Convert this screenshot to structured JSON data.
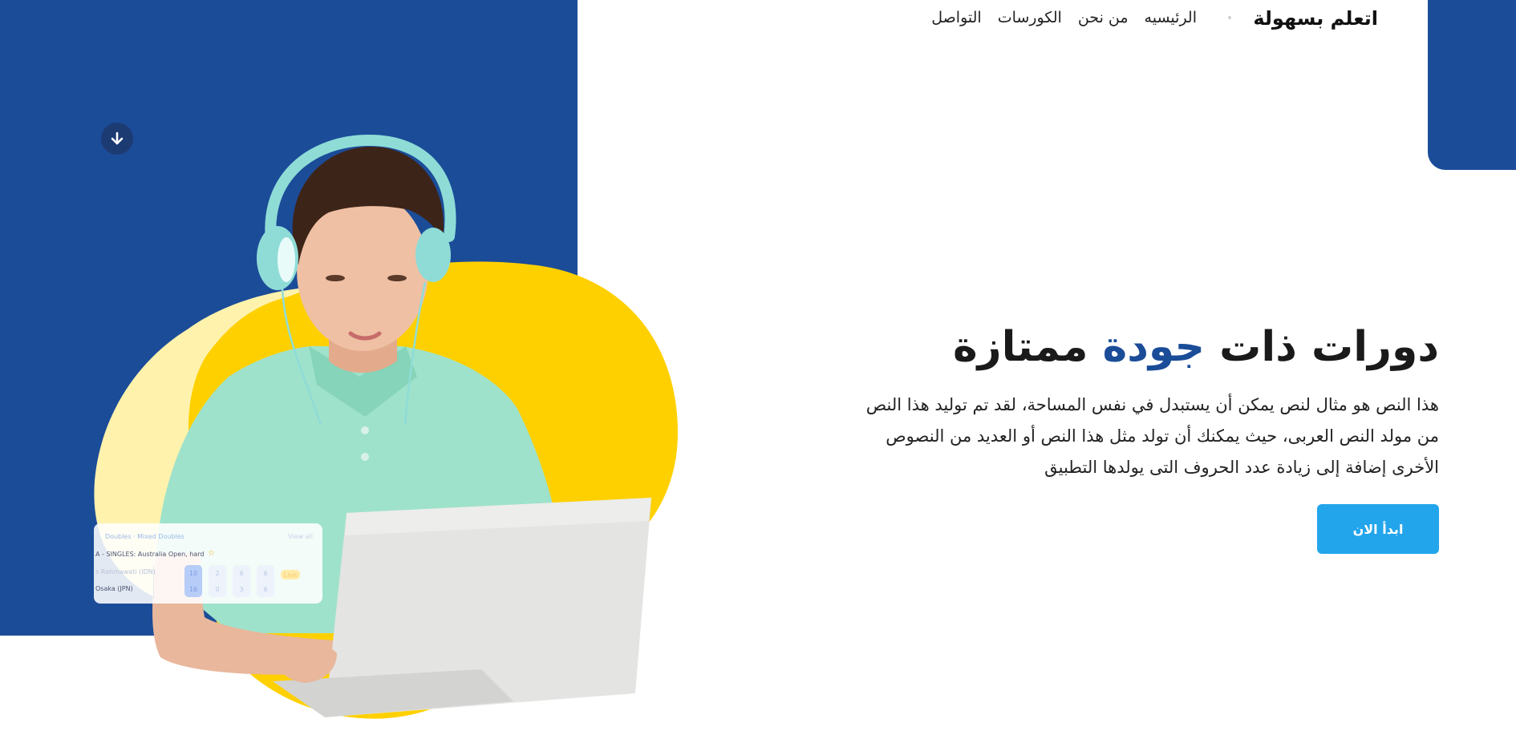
{
  "header": {
    "brand": "اتعلم بسهولة",
    "nav": [
      "الرئيسيه",
      "من نحن",
      "الكورسات",
      "التواصل"
    ]
  },
  "hero": {
    "title_part1": "دورات ذات",
    "title_accent": "جودة",
    "title_part2": "ممتازة",
    "description": "هذا النص هو مثال لنص يمكن أن يستبدل في نفس المساحة، لقد تم توليد هذا النص من مولد النص العربى، حيث يمكنك أن تولد مثل هذا النص أو العديد من النصوص الأخرى إضافة إلى زيادة عدد الحروف التى يولدها التطبيق",
    "cta_label": "ابدأ الان"
  },
  "widget": {
    "title": "Doubles · Mixed Doubles",
    "link": "View all",
    "event": "A - SINGLES: Australia Open, hard",
    "player1": "s Rahmawati (IDN)",
    "player2": "Osaka (JPN)",
    "scores": [
      {
        "top": "10",
        "bottom": "16"
      },
      {
        "top": "2",
        "bottom": "0"
      },
      {
        "top": "6",
        "bottom": "3"
      },
      {
        "top": "6",
        "bottom": "6"
      }
    ],
    "badge": "Live"
  },
  "icons": {
    "scroll": "arrow-down-icon",
    "star": "star-icon"
  },
  "colors": {
    "primary_blue": "#1b4c98",
    "accent_yellow": "#ffd000",
    "cta_blue": "#23a5ec",
    "shirt_mint": "#9fe2cb"
  }
}
